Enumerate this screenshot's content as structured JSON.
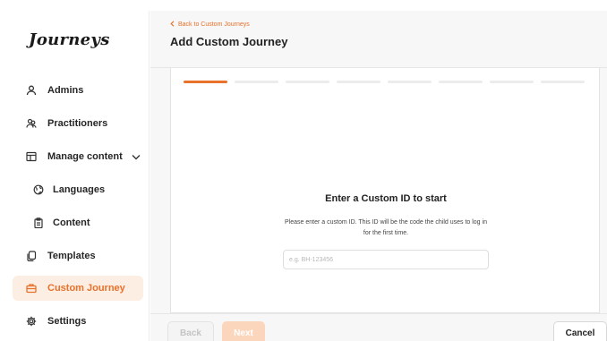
{
  "app": {
    "logo": "Journeys",
    "accent": "#e8712b"
  },
  "sidebar": {
    "items": [
      {
        "label": "Admins",
        "icon": "person-icon"
      },
      {
        "label": "Practitioners",
        "icon": "people-icon"
      },
      {
        "label": "Manage content",
        "icon": "layout-icon",
        "expanded": true
      },
      {
        "label": "Languages",
        "icon": "globe-icon"
      },
      {
        "label": "Content",
        "icon": "clipboard-icon"
      },
      {
        "label": "Templates",
        "icon": "copy-icon"
      },
      {
        "label": "Custom Journey",
        "icon": "briefcase-icon",
        "active": true
      },
      {
        "label": "Settings",
        "icon": "gear-icon"
      }
    ]
  },
  "header": {
    "back_link": "Back to Custom Journeys",
    "title": "Add Custom Journey"
  },
  "wizard": {
    "total_steps": 8,
    "current_step": 1,
    "heading": "Enter a Custom ID to start",
    "description": "Please enter a custom ID. This ID will be the code the child uses to log in for the first time.",
    "input": {
      "value": "",
      "placeholder": "e.g. BH-123456"
    }
  },
  "footer": {
    "back_label": "Back",
    "next_label": "Next",
    "cancel_label": "Cancel"
  }
}
